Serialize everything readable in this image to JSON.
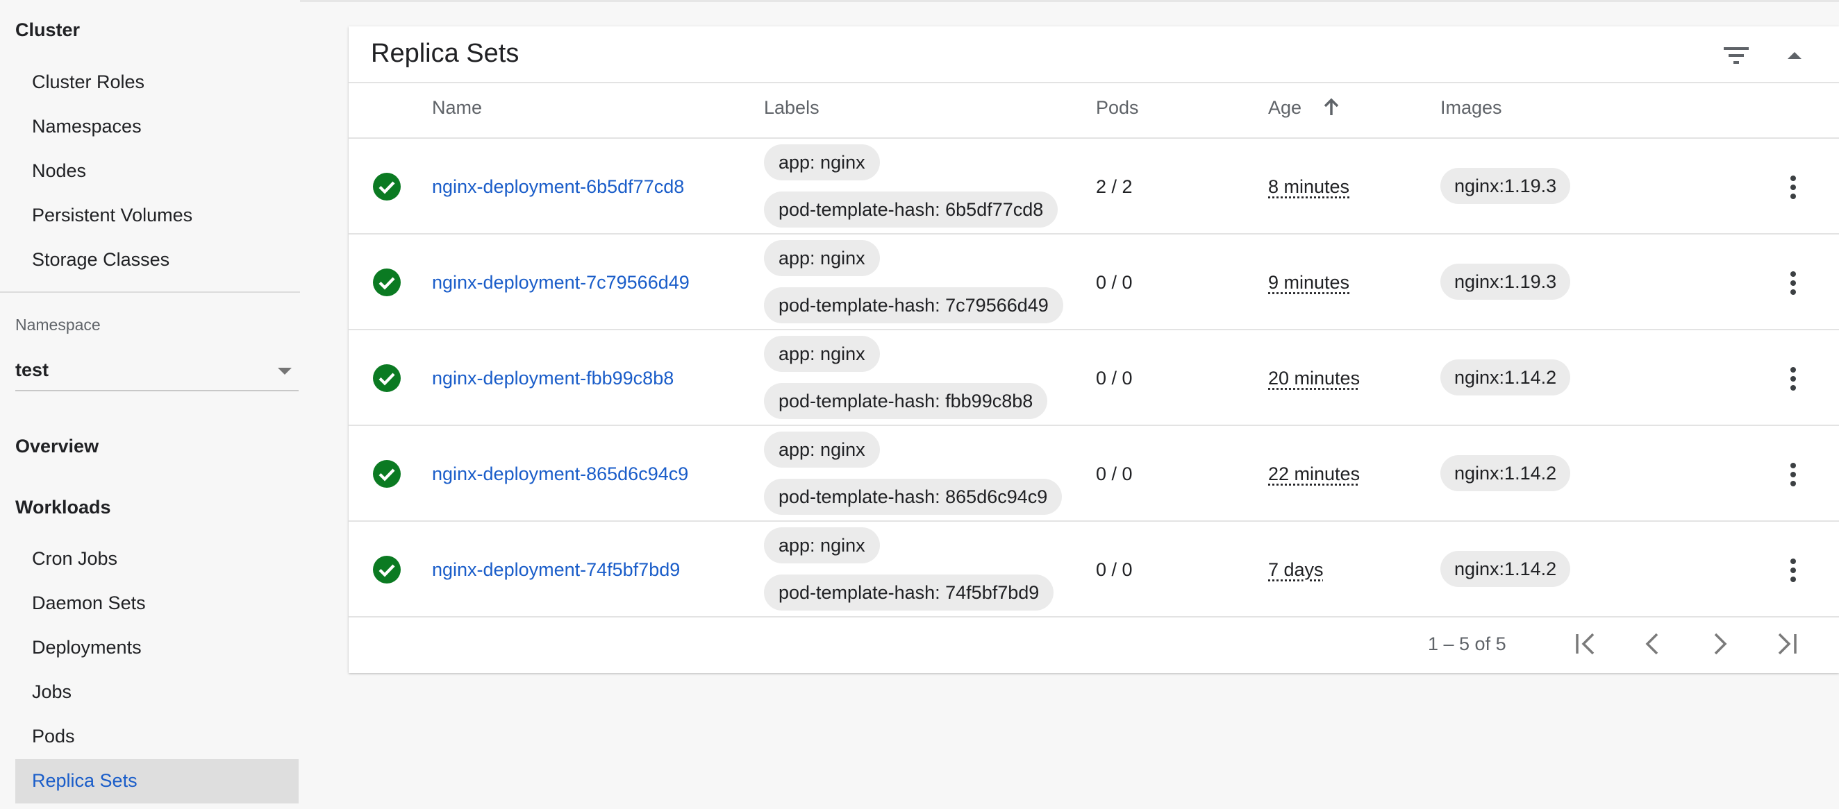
{
  "sidebar": {
    "cluster_heading": "Cluster",
    "cluster_items": [
      "Cluster Roles",
      "Namespaces",
      "Nodes",
      "Persistent Volumes",
      "Storage Classes"
    ],
    "namespace_label": "Namespace",
    "namespace_value": "test",
    "overview": "Overview",
    "workloads_heading": "Workloads",
    "workload_items": [
      "Cron Jobs",
      "Daemon Sets",
      "Deployments",
      "Jobs",
      "Pods",
      "Replica Sets"
    ],
    "active_item": "Replica Sets"
  },
  "card": {
    "title": "Replica Sets",
    "columns": {
      "name": "Name",
      "labels": "Labels",
      "pods": "Pods",
      "age": "Age",
      "images": "Images"
    },
    "sort": {
      "column": "Age",
      "direction": "ascending"
    },
    "rows": [
      {
        "status": "running",
        "name": "nginx-deployment-6b5df77cd8",
        "labels": [
          "app: nginx",
          "pod-template-hash: 6b5df77cd8"
        ],
        "pods": "2 / 2",
        "age": "8 minutes",
        "image": "nginx:1.19.3"
      },
      {
        "status": "running",
        "name": "nginx-deployment-7c79566d49",
        "labels": [
          "app: nginx",
          "pod-template-hash: 7c79566d49"
        ],
        "pods": "0 / 0",
        "age": "9 minutes",
        "image": "nginx:1.19.3"
      },
      {
        "status": "running",
        "name": "nginx-deployment-fbb99c8b8",
        "labels": [
          "app: nginx",
          "pod-template-hash: fbb99c8b8"
        ],
        "pods": "0 / 0",
        "age": "20 minutes",
        "image": "nginx:1.14.2"
      },
      {
        "status": "running",
        "name": "nginx-deployment-865d6c94c9",
        "labels": [
          "app: nginx",
          "pod-template-hash: 865d6c94c9"
        ],
        "pods": "0 / 0",
        "age": "22 minutes",
        "image": "nginx:1.14.2"
      },
      {
        "status": "running",
        "name": "nginx-deployment-74f5bf7bd9",
        "labels": [
          "app: nginx",
          "pod-template-hash: 74f5bf7bd9"
        ],
        "pods": "0 / 0",
        "age": "7 days",
        "image": "nginx:1.14.2"
      }
    ],
    "pagination": {
      "range": "1 – 5 of 5",
      "buttons": [
        "first-page",
        "previous-page",
        "next-page",
        "last-page"
      ]
    }
  },
  "colors": {
    "link": "#1a5dc9",
    "success": "#0b7a22",
    "selected_bg": "#dedede",
    "chip_bg": "#ebebeb"
  },
  "icons": [
    "filter-icon",
    "collapse-icon",
    "sort-arrow-up-icon",
    "check-circle-icon",
    "more-vert-icon",
    "first-page-icon",
    "chevron-left-icon",
    "chevron-right-icon",
    "last-page-icon",
    "dropdown-caret-icon"
  ]
}
